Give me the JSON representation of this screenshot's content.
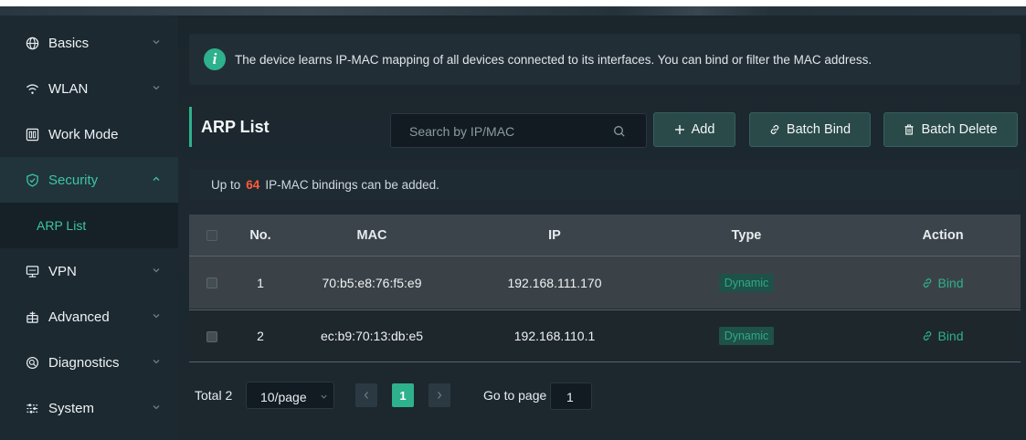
{
  "sidebar": {
    "items": [
      {
        "label": "Basics",
        "icon": "globe-icon"
      },
      {
        "label": "WLAN",
        "icon": "wifi-icon"
      },
      {
        "label": "Work Mode",
        "icon": "work-mode-icon"
      },
      {
        "label": "Security",
        "icon": "shield-check-icon"
      },
      {
        "label": "VPN",
        "icon": "vpn-icon"
      },
      {
        "label": "Advanced",
        "icon": "advanced-icon"
      },
      {
        "label": "Diagnostics",
        "icon": "diagnostics-icon"
      },
      {
        "label": "System",
        "icon": "system-icon"
      }
    ],
    "sub_item": {
      "label": "ARP List"
    }
  },
  "info": {
    "text": "The device learns IP-MAC mapping of all devices connected to its interfaces. You can bind or filter the MAC address."
  },
  "page": {
    "title": "ARP List"
  },
  "search": {
    "placeholder": "Search by IP/MAC"
  },
  "toolbar": {
    "add_label": "Add",
    "batch_bind_label": "Batch Bind",
    "batch_delete_label": "Batch Delete"
  },
  "limit": {
    "prefix": "Up to",
    "count": "64",
    "suffix": "IP-MAC bindings can be added."
  },
  "table": {
    "columns": [
      "No.",
      "MAC",
      "IP",
      "Type",
      "Action"
    ],
    "rows": [
      {
        "no": "1",
        "mac": "70:b5:e8:76:f5:e9",
        "ip": "192.168.111.170",
        "type": "Dynamic",
        "action": "Bind"
      },
      {
        "no": "2",
        "mac": "ec:b9:70:13:db:e5",
        "ip": "192.168.110.1",
        "type": "Dynamic",
        "action": "Bind"
      }
    ]
  },
  "pagination": {
    "total_label": "Total 2",
    "page_size": "10/page",
    "current_page": "1",
    "goto_label": "Go to page",
    "goto_value": "1"
  },
  "colors": {
    "accent": "#2eb18d",
    "highlight_number": "#ff5b3a",
    "background": "#1c272e"
  }
}
